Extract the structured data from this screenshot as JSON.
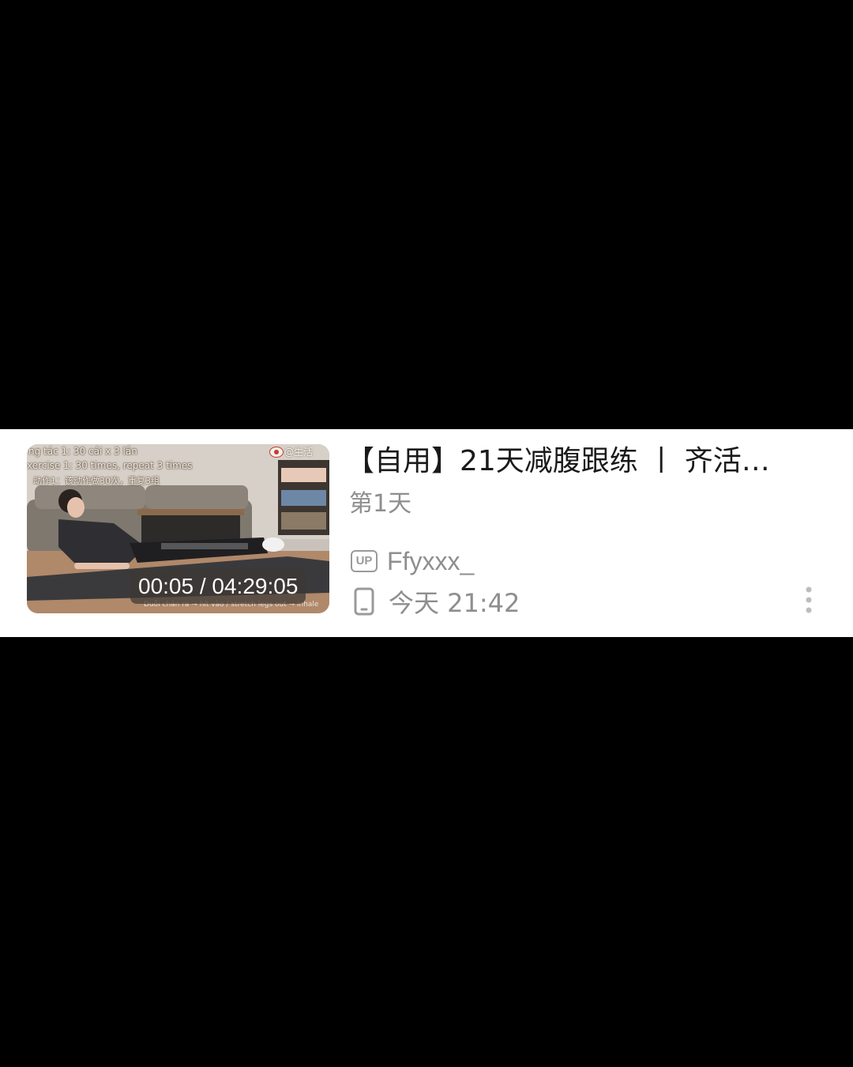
{
  "video_card": {
    "thumbnail": {
      "captions": {
        "line1": "ng tác 1: 30 cái x 3 lần",
        "line2": "xercise 1: 30 times, repeat 3 times",
        "line3": "动作1：该动作做30次，重复3组",
        "line4": "Duỗi chân ra → hít vào / stretch legs out → inhale"
      },
      "watermark": "@生活",
      "duration": "00:05 / 04:29:05"
    },
    "title": "【自用】21天减腹跟练 丨 齐活…",
    "subtitle": "第1天",
    "uploader": {
      "badge": "UP",
      "name": "Ffyxxx_"
    },
    "watched": {
      "icon": "phone-icon",
      "time": "今天 21:42"
    },
    "more_icon": "more-vertical-icon"
  }
}
